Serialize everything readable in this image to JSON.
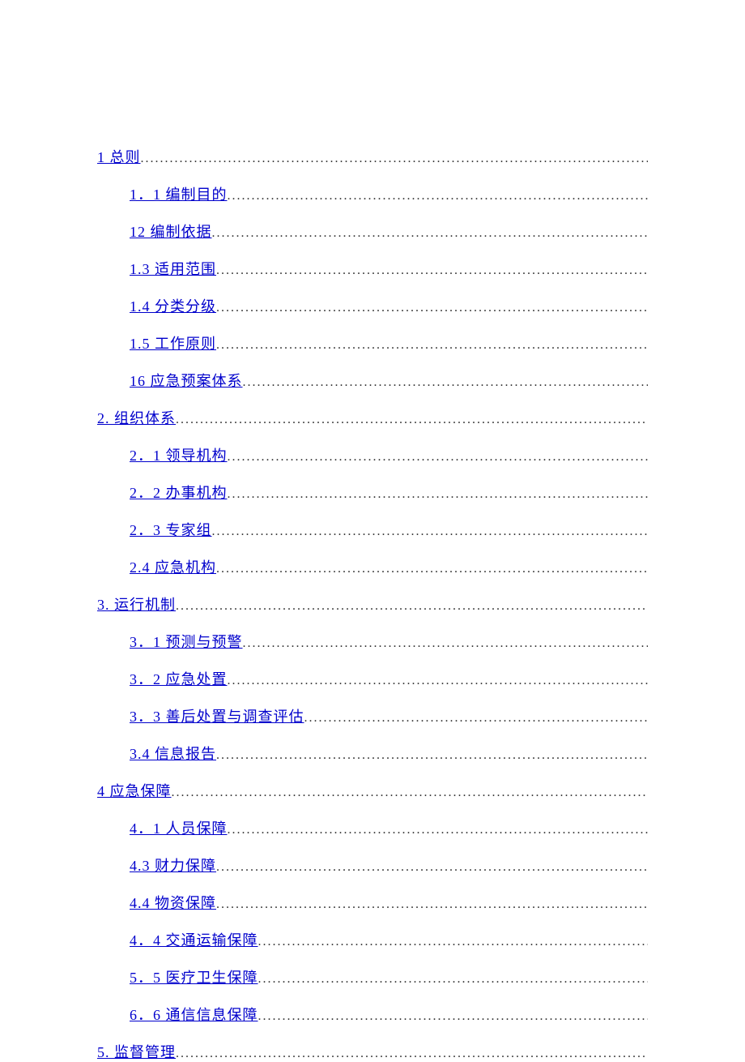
{
  "toc": [
    {
      "level": 1,
      "label": "1 总则"
    },
    {
      "level": 2,
      "label": "1．1 编制目的"
    },
    {
      "level": 2,
      "label": "12 编制依据"
    },
    {
      "level": 2,
      "label": "1.3  适用范围"
    },
    {
      "level": 2,
      "label": "1.4  分类分级"
    },
    {
      "level": 2,
      "label": "1.5  工作原则"
    },
    {
      "level": 2,
      "label": "16 应急预案体系"
    },
    {
      "level": 1,
      "label": "2. 组织体系"
    },
    {
      "level": 2,
      "label": "2．1 领导机构"
    },
    {
      "level": 2,
      "label": "2．2 办事机构"
    },
    {
      "level": 2,
      "label": "2．3 专家组"
    },
    {
      "level": 2,
      "label": "2.4 应急机构"
    },
    {
      "level": 1,
      "label": "3. 运行机制"
    },
    {
      "level": 2,
      "label": "3．1 预测与预警"
    },
    {
      "level": 2,
      "label": "3．2 应急处置"
    },
    {
      "level": 2,
      "label": "3．3 善后处置与调查评估"
    },
    {
      "level": 2,
      "label": "3.4 信息报告"
    },
    {
      "level": 1,
      "label": "4 应急保障"
    },
    {
      "level": 2,
      "label": "4．1 人员保障"
    },
    {
      "level": 2,
      "label": "4.3  财力保障"
    },
    {
      "level": 2,
      "label": "4.4  物资保障"
    },
    {
      "level": 2,
      "label": "4．4 交通运输保障"
    },
    {
      "level": 2,
      "label": "5．5 医疗卫生保障"
    },
    {
      "level": 2,
      "label": "6．6 通信信息保障"
    },
    {
      "level": 1,
      "label": "5. 监督管理"
    }
  ]
}
